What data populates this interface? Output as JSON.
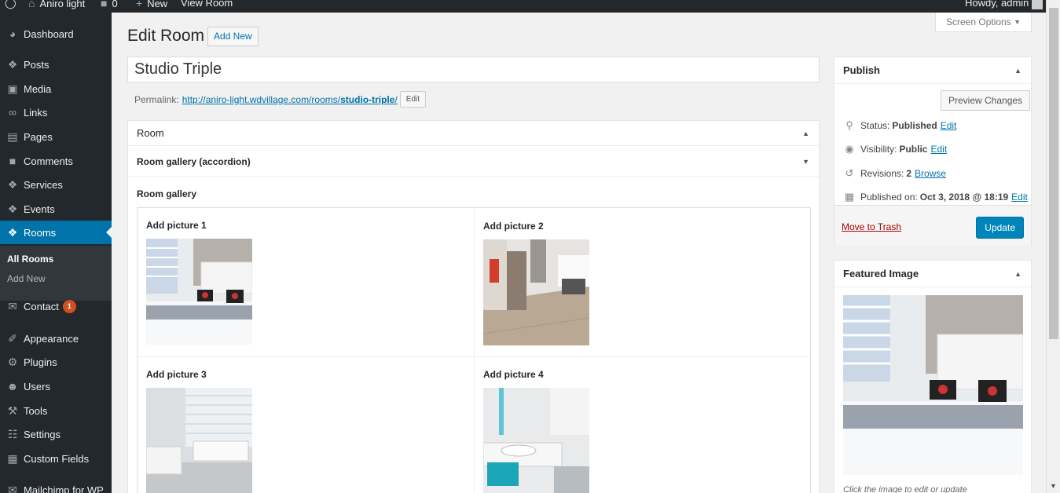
{
  "admin_bar": {
    "site_name": "Aniro light",
    "comments_count": "0",
    "new_label": "New",
    "view_label": "View Room",
    "howdy": "Howdy, admin"
  },
  "sidebar": {
    "items": [
      {
        "label": "Dashboard",
        "icon": "dashboard-icon"
      },
      {
        "label": "Posts",
        "icon": "pin-icon"
      },
      {
        "label": "Media",
        "icon": "media-icon"
      },
      {
        "label": "Links",
        "icon": "link-icon"
      },
      {
        "label": "Pages",
        "icon": "pages-icon"
      },
      {
        "label": "Comments",
        "icon": "comment-icon"
      },
      {
        "label": "Services",
        "icon": "pin-icon"
      },
      {
        "label": "Events",
        "icon": "pin-icon"
      },
      {
        "label": "Rooms",
        "icon": "pin-icon"
      },
      {
        "label": "Contact",
        "icon": "mail-icon",
        "badge": "1"
      },
      {
        "label": "Appearance",
        "icon": "brush-icon"
      },
      {
        "label": "Plugins",
        "icon": "plugin-icon"
      },
      {
        "label": "Users",
        "icon": "user-icon"
      },
      {
        "label": "Tools",
        "icon": "wrench-icon"
      },
      {
        "label": "Settings",
        "icon": "settings-icon"
      },
      {
        "label": "Custom Fields",
        "icon": "grid-icon"
      },
      {
        "label": "Mailchimp for WP",
        "icon": "mail-icon"
      }
    ],
    "submenu": {
      "all": "All Rooms",
      "add_new": "Add New"
    },
    "accent": "#0073aa"
  },
  "header": {
    "screen_options": "Screen Options",
    "title": "Edit Room",
    "add_new": "Add New"
  },
  "post": {
    "title": "Studio Triple",
    "permalink_label": "Permalink:",
    "permalink_base": "http://aniro-light.wdvillage.com/rooms/",
    "permalink_slug": "studio-triple",
    "permalink_end": "/",
    "edit_label": "Edit"
  },
  "room_box": {
    "title": "Room",
    "accordion_title": "Room gallery (accordion)",
    "gallery_title": "Room gallery",
    "pictures": [
      {
        "label": "Add picture 1"
      },
      {
        "label": "Add picture 2"
      },
      {
        "label": "Add picture 3"
      },
      {
        "label": "Add picture 4"
      }
    ]
  },
  "publish": {
    "title": "Publish",
    "preview": "Preview Changes",
    "status_label": "Status:",
    "status_value": "Published",
    "visibility_label": "Visibility:",
    "visibility_value": "Public",
    "revisions_label": "Revisions:",
    "revisions_value": "2",
    "published_label": "Published on:",
    "published_value": "Oct 3, 2018 @ 18:19",
    "edit": "Edit",
    "browse": "Browse",
    "trash": "Move to Trash",
    "update": "Update"
  },
  "featured": {
    "title": "Featured Image",
    "hint": "Click the image to edit or update"
  }
}
